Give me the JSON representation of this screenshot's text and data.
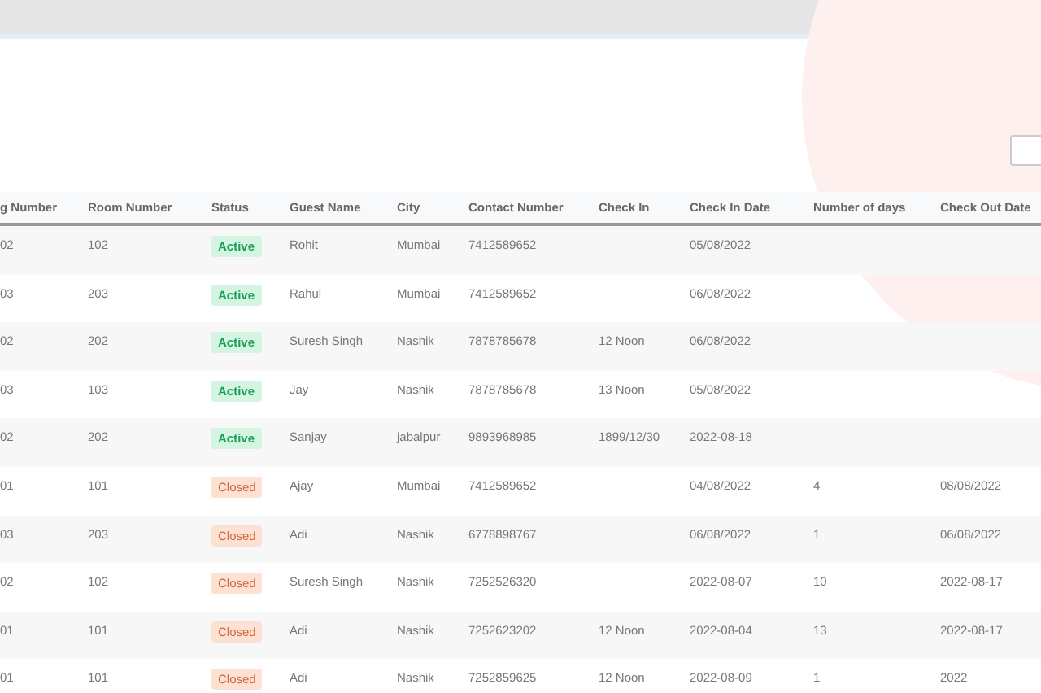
{
  "table": {
    "columns": [
      "g Number",
      "Room Number",
      "Status",
      "Guest Name",
      "City",
      "Contact Number",
      "Check In",
      "Check In Date",
      "Number of days",
      "Check Out Date"
    ],
    "rows": [
      {
        "booking": "02",
        "room": "102",
        "status": {
          "label": "Active",
          "kind": "active"
        },
        "guest": "Rohit",
        "city": "Mumbai",
        "contact": "7412589652",
        "check_in_date": "05/08/2022"
      },
      {
        "booking": "03",
        "room": "203",
        "status": {
          "label": "Active",
          "kind": "active"
        },
        "guest": "Rahul",
        "city": "Mumbai",
        "contact": "7412589652",
        "check_in_date": "06/08/2022"
      },
      {
        "booking": "02",
        "room": "202",
        "status": {
          "label": "Active",
          "kind": "active"
        },
        "guest": "Suresh Singh",
        "city": "Nashik",
        "contact": "7878785678",
        "check_in": "12 Noon",
        "check_in_date": "06/08/2022"
      },
      {
        "booking": "03",
        "room": "103",
        "status": {
          "label": "Active",
          "kind": "active"
        },
        "guest": "Jay",
        "city": "Nashik",
        "contact": "7878785678",
        "check_in": "13 Noon",
        "check_in_date": "05/08/2022"
      },
      {
        "booking": "02",
        "room": "202",
        "status": {
          "label": "Active",
          "kind": "active"
        },
        "guest": "Sanjay",
        "city": "jabalpur",
        "contact": "9893968985",
        "check_in": "1899/12/30",
        "check_in_date": "2022-08-18"
      },
      {
        "booking": "01",
        "room": "101",
        "status": {
          "label": "Closed",
          "kind": "closed"
        },
        "guest": "Ajay",
        "city": "Mumbai",
        "contact": "7412589652",
        "check_in_date": "04/08/2022",
        "days": "4",
        "check_out_date": "08/08/2022"
      },
      {
        "booking": "03",
        "room": "203",
        "status": {
          "label": "Closed",
          "kind": "closed"
        },
        "guest": "Adi",
        "city": "Nashik",
        "contact": "6778898767",
        "check_in_date": "06/08/2022",
        "days": "1",
        "check_out_date": "06/08/2022"
      },
      {
        "booking": "02",
        "room": "102",
        "status": {
          "label": "Closed",
          "kind": "closed"
        },
        "guest": "Suresh Singh",
        "city": "Nashik",
        "contact": "7252526320",
        "check_in_date": "2022-08-07",
        "days": "10",
        "check_out_date": "2022-08-17"
      },
      {
        "booking": "01",
        "room": "101",
        "status": {
          "label": "Closed",
          "kind": "closed"
        },
        "guest": "Adi",
        "city": "Nashik",
        "contact": "7252623202",
        "check_in": "12 Noon",
        "check_in_date": "2022-08-04",
        "days": "13",
        "check_out_date": "2022-08-17"
      },
      {
        "booking": "01",
        "room": "101",
        "status": {
          "label": "Closed",
          "kind": "closed"
        },
        "guest": "Adi",
        "city": "Nashik",
        "contact": "7252859625",
        "check_in": "12 Noon",
        "check_in_date": "2022-08-09",
        "days": "1",
        "check_out_date": "2022"
      }
    ]
  }
}
